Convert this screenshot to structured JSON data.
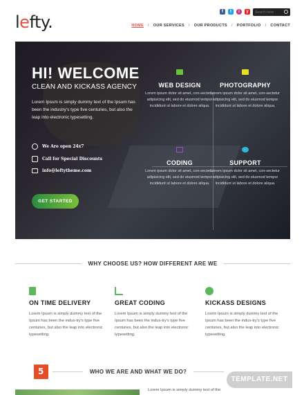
{
  "header": {
    "logo": {
      "first": "l",
      "accent": "e",
      "rest": "fty."
    },
    "search": {
      "placeholder": "Search here"
    },
    "social": [
      {
        "icon": "facebook-icon",
        "color": "#3b5998",
        "glyph": "f"
      },
      {
        "icon": "twitter-icon",
        "color": "#1da1f2",
        "glyph": "t"
      },
      {
        "icon": "instagram-icon",
        "color": "#c13584",
        "glyph": "i"
      },
      {
        "icon": "youtube-icon",
        "color": "#e62117",
        "glyph": "y"
      }
    ],
    "nav": [
      "HOME",
      "OUR SERVICES",
      "OUR PRODUCTS",
      "PORTFOLIO",
      "CONTACT"
    ],
    "nav_separator": "/",
    "accent_color": "#e84a3c"
  },
  "hero": {
    "title": "HI! WELCOME",
    "subtitle": "CLEAN AND KICKASS AGENCY",
    "text": "Lorem Ipsum is simply dummy text of the Ipsum has been the industry's type five centuries, but also the leap into electronic typesetting.",
    "open": "We Are open 24x7",
    "call": "Call for Special Discounts",
    "email": "info@leftytheme.com",
    "cta": "GET STARTED",
    "features": [
      {
        "title": "WEB DESIGN",
        "text": "Lorem ipsum dolor sit amet, con-sectetur adipisicing elit, sed do eiusmod tempor incididunt ut labore et dolore aliqua.",
        "icon": "monitor-icon",
        "color": "#6ac13a"
      },
      {
        "title": "PHOTOGRAPHY",
        "text": "Lorem ipsum dolor sit amet, con-sectetur adipisicing elit, sed do eiusmod tempor incididunt ut labore et dolore aliqua.",
        "icon": "camera-icon",
        "color": "#e4e02a"
      },
      {
        "title": "CODING",
        "text": "Lorem ipsum dolor sit amet, con-sectetur adipisicing elit, sed do eiusmod tempor incididunt ut labore et dolore aliqua.",
        "icon": "code-icon",
        "color": "#a44ad8"
      },
      {
        "title": "SUPPORT",
        "text": "Lorem ipsum dolor sit amet, con-sectetur adipisicing elit, sed do eiusmod tempor incididunt ut labore et dolore aliqua.",
        "icon": "chat-icon",
        "color": "#34b5d8"
      }
    ]
  },
  "why": {
    "heading": "WHY CHOOSE US? HOW DIFFERENT ARE WE",
    "items": [
      {
        "title": "ON TIME DELIVERY",
        "text": "Lorem Ipsum is simply dummy text of the Ipsum has been the indus-try's type five centuries, but also the leap into electronic typesetting.",
        "icon": "document-icon",
        "color": "#5cb85c"
      },
      {
        "title": "GREAT CODING",
        "text": "Lorem Ipsum is simply dummy text of the Ipsum has been the indus-try's type five centuries, but also the leap into electronic typesetting.",
        "icon": "chart-icon",
        "color": "#5cb85c"
      },
      {
        "title": "KICKASS DESIGNS",
        "text": "Lorem Ipsum is simply dummy text of the Ipsum has been the indus-try's type five centuries, but also the leap into electronic typesetting.",
        "icon": "users-icon",
        "color": "#5cb85c"
      }
    ]
  },
  "who": {
    "heading": "WHO WE ARE AND WHAT WE DO?",
    "text": "Lorem Ipsum is simply dummy text of the"
  },
  "watermark": "TEMPLATE.NET"
}
